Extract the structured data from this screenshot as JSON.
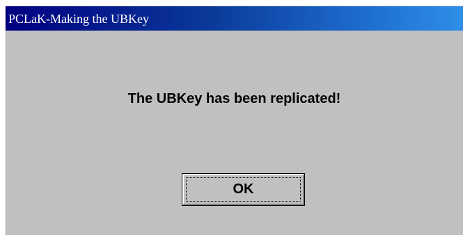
{
  "window": {
    "title": "PCLaK-Making the UBKey"
  },
  "dialog": {
    "message": "The UBKey has been replicated!",
    "ok_label": "OK"
  },
  "colors": {
    "title_bar_start": "#000080",
    "title_bar_end": "#2e8ee6",
    "dialog_background": "#c0c0c0"
  }
}
